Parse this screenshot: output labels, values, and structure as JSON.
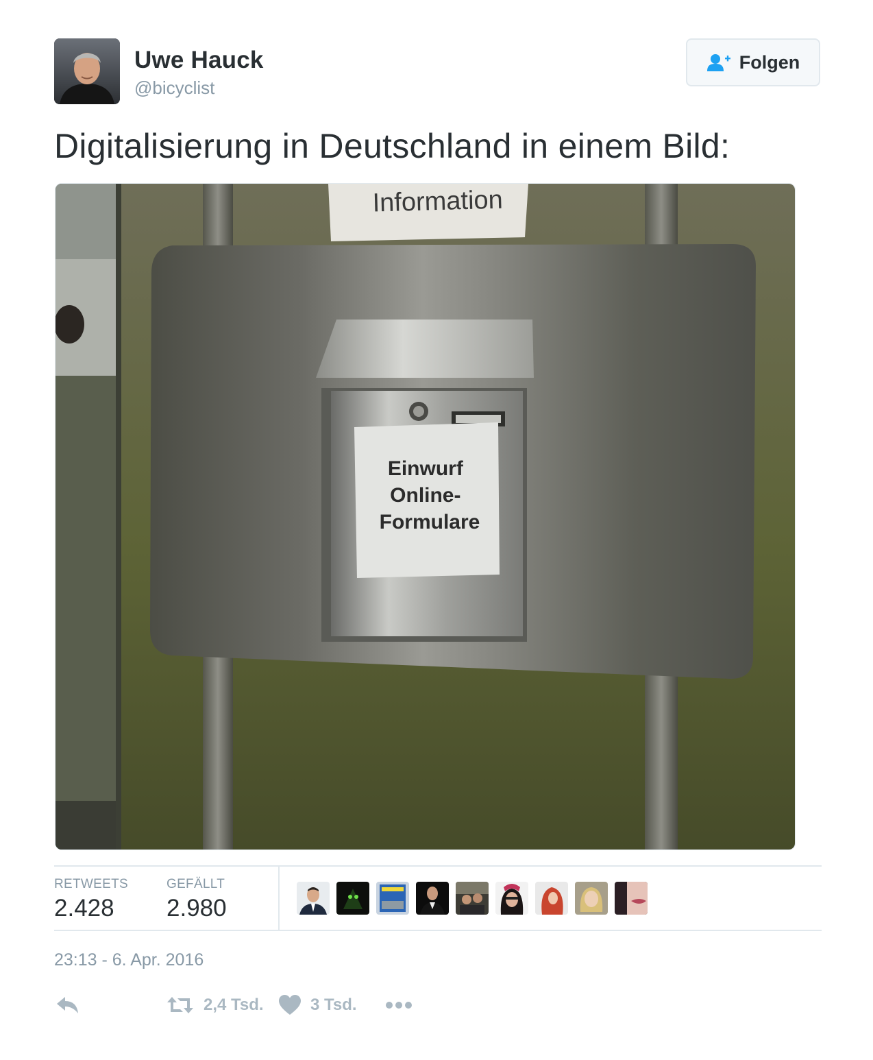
{
  "author": {
    "name": "Uwe Hauck",
    "handle": "@bicyclist",
    "avatar_icon": "profile-photo"
  },
  "follow_button": {
    "label": "Folgen",
    "icon": "add-user-icon"
  },
  "tweet": {
    "text": "Digitalisierung in Deutschland in einem Bild:",
    "media": {
      "header_sign": "Information",
      "sign_lines": [
        "Einwurf",
        "Online-",
        "Formulare"
      ]
    }
  },
  "stats": {
    "retweets_label": "RETWEETS",
    "retweets_value": "2.428",
    "likes_label": "GEFÄLLT",
    "likes_value": "2.980"
  },
  "likers": [
    {
      "icon": "avatar-man-suit"
    },
    {
      "icon": "avatar-dark-green"
    },
    {
      "icon": "avatar-book-cover"
    },
    {
      "icon": "avatar-man-black-suit"
    },
    {
      "icon": "avatar-group-photo"
    },
    {
      "icon": "avatar-woman-dark-hair"
    },
    {
      "icon": "avatar-red-hair"
    },
    {
      "icon": "avatar-blonde"
    },
    {
      "icon": "avatar-lips"
    }
  ],
  "timestamp": "23:13 - 6. Apr. 2016",
  "actions": {
    "reply_icon": "reply-icon",
    "retweet_icon": "retweet-icon",
    "retweet_count": "2,4 Tsd.",
    "like_icon": "heart-icon",
    "like_count": "3 Tsd.",
    "more_icon": "more-icon"
  },
  "colors": {
    "text": "#292f33",
    "secondary": "#8899a6",
    "icon_gray": "#aab8c2",
    "border": "#e1e8ed",
    "follow_icon": "#1da1f2"
  }
}
